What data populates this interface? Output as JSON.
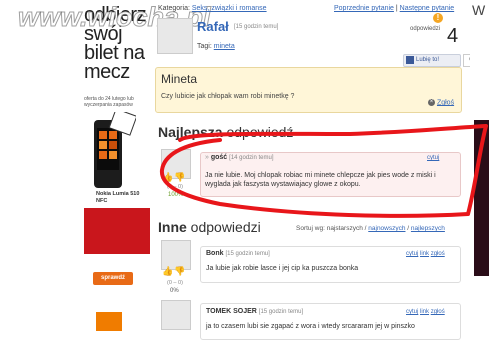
{
  "watermark": "www.wiocha.pl",
  "ad": {
    "headline": "odbierz swój bilet na mecz",
    "offer": "oferta do 24 lutego lub wyczerpania zapasów",
    "phone": "Nokia Lumia 510 NFC",
    "button": "sprawdź"
  },
  "breadcrumb": {
    "label": "Kategoria:",
    "category": "Seks, związki i romanse",
    "prev": "Poprzednie pytanie",
    "separator": "|",
    "next": "Następne pytanie"
  },
  "question": {
    "author": "Rafał",
    "time": "[15 godzin temu]",
    "tags_label": "Tagi:",
    "tag": "mineta",
    "votes_label": "odpowiedzi",
    "votes": "4",
    "fb_like": "Lubię to!",
    "like_count": "0",
    "title": "Mineta",
    "text": "Czy lubicie jak chłopak wam robi minetkę ?",
    "report": "Zgłoś"
  },
  "best": {
    "title_bold": "Najlepsza",
    "title_rest": " odpowiedź",
    "author": "gość",
    "time": "[14 godzin temu]",
    "action": "cytuj",
    "text": "Ja nie lubie. Moj chlopak robiac mi minete chlepcze jak pies wode z miski i wyglada jak faszysta wystawiajacy glowe z okopu.",
    "score": "(4 – 0)",
    "percent": "100%"
  },
  "others": {
    "title_bold": "Inne",
    "title_rest": " odpowiedzi",
    "sort_label": "Sortuj wg: najstarszych /",
    "sort_new": "najnowszych",
    "sort_sep": "/",
    "sort_best": "najlepszych",
    "answers": [
      {
        "author": "Bonk",
        "time": "[15 godzin temu]",
        "text": "Ja lubie jak robie lasce i jej cip ka puszcza bonka",
        "score": "(0 – 0)",
        "percent": "0%",
        "actions": [
          "cytuj",
          "link",
          "zgłoś"
        ]
      },
      {
        "author": "TOMEK SOJER",
        "time": "[15 godzin temu]",
        "text": "ja to czasem lubi sie zgapać z wora i wtedy srcararam jej w pinszko",
        "actions": [
          "cytuj",
          "link",
          "zgłoś"
        ]
      }
    ]
  },
  "right": {
    "initial": "W"
  },
  "colors": {
    "link": "#3568b8",
    "annotation": "#e8161a",
    "question_bg": "#fff6d8",
    "best_bg": "#fdf0f0",
    "orange": "#f07c00"
  }
}
